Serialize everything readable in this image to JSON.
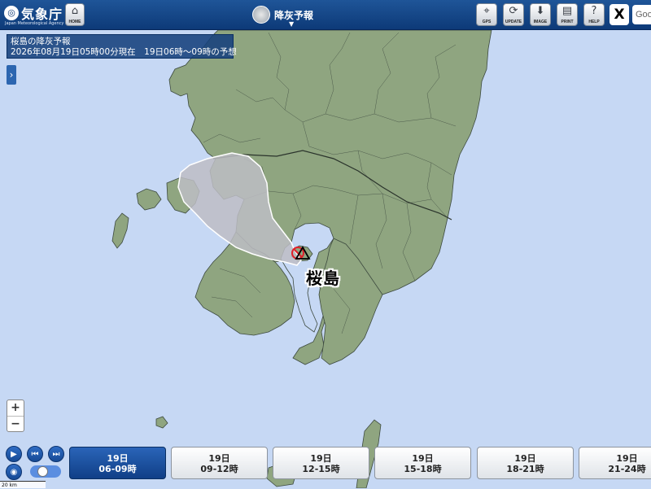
{
  "header": {
    "agency_name": "気象庁",
    "agency_sub": "Japan Meteorological Agency",
    "home_label": "HOME",
    "product_title": "降灰予報",
    "tools": [
      {
        "label": "GPS",
        "icon": "gps-icon"
      },
      {
        "label": "UPDATE",
        "icon": "update-icon"
      },
      {
        "label": "IMAGE",
        "icon": "download-icon"
      },
      {
        "label": "PRINT",
        "icon": "print-icon"
      },
      {
        "label": "HELP",
        "icon": "help-icon"
      }
    ],
    "x_label": "X",
    "search_placeholder": "Goo"
  },
  "info": {
    "title": "桜島の降灰予報",
    "line2": "2026年08月19日05時00分現在　19日06時～09時の予想"
  },
  "map": {
    "volcano_name": "桜島",
    "land_color": "#8fa580",
    "sea_color": "#c6d8f4",
    "ash_color": "#bdbdc4"
  },
  "zoom": {
    "in": "+",
    "out": "−"
  },
  "timeline": [
    {
      "day": "19日",
      "hours": "06-09時",
      "active": true
    },
    {
      "day": "19日",
      "hours": "09-12時",
      "active": false
    },
    {
      "day": "19日",
      "hours": "12-15時",
      "active": false
    },
    {
      "day": "19日",
      "hours": "15-18時",
      "active": false
    },
    {
      "day": "19日",
      "hours": "18-21時",
      "active": false
    },
    {
      "day": "19日",
      "hours": "21-24時",
      "active": false
    }
  ],
  "scale_label": "20 km"
}
